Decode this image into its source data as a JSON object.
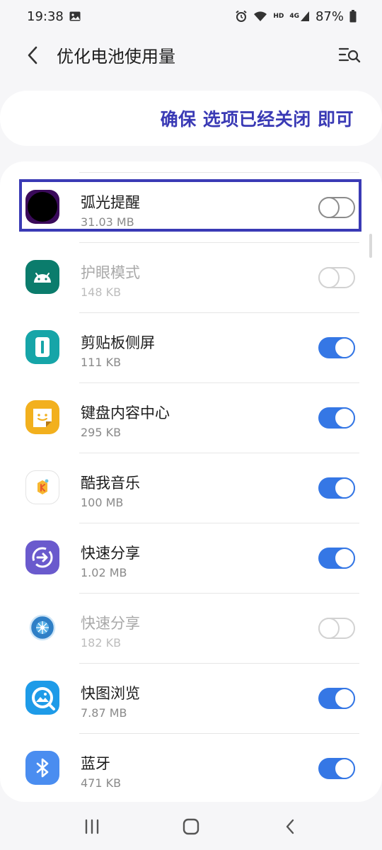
{
  "status_bar": {
    "time": "19:38",
    "network_label": "HD",
    "signal_label": "4G",
    "battery_percent": "87%"
  },
  "header": {
    "title": "优化电池使用量",
    "back_icon": "chevron-left-icon",
    "search_icon": "list-search-icon"
  },
  "banner": {
    "text": "确保 选项已经关闭 即可"
  },
  "apps": [
    {
      "name": "弧光提醒",
      "size": "31.03 MB",
      "toggle": "off",
      "enabled": true,
      "highlighted": true,
      "icon": "arc-reminder-icon"
    },
    {
      "name": "护眼模式",
      "size": "148 KB",
      "toggle": "off",
      "enabled": false,
      "icon": "android-icon"
    },
    {
      "name": "剪贴板侧屏",
      "size": "111 KB",
      "toggle": "on",
      "enabled": true,
      "icon": "clipboard-edge-icon"
    },
    {
      "name": "键盘内容中心",
      "size": "295 KB",
      "toggle": "on",
      "enabled": true,
      "icon": "keyboard-content-icon"
    },
    {
      "name": "酷我音乐",
      "size": "100 MB",
      "toggle": "on",
      "enabled": true,
      "icon": "kuwo-music-icon"
    },
    {
      "name": "快速分享",
      "size": "1.02 MB",
      "toggle": "on",
      "enabled": true,
      "icon": "quick-share-icon"
    },
    {
      "name": "快速分享",
      "size": "182 KB",
      "toggle": "off",
      "enabled": false,
      "icon": "quick-share-globe-icon"
    },
    {
      "name": "快图浏览",
      "size": "7.87 MB",
      "toggle": "on",
      "enabled": true,
      "icon": "quickpic-icon"
    },
    {
      "name": "蓝牙",
      "size": "471 KB",
      "toggle": "on",
      "enabled": true,
      "icon": "bluetooth-icon"
    }
  ],
  "colors": {
    "accent": "#3577e5",
    "banner_text": "#3a3ab5",
    "highlight_border": "#3a3ab5"
  }
}
